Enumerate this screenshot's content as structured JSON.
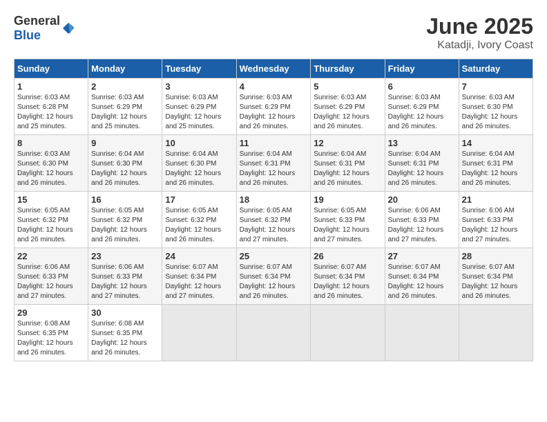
{
  "header": {
    "logo_general": "General",
    "logo_blue": "Blue",
    "month": "June 2025",
    "location": "Katadji, Ivory Coast"
  },
  "days_of_week": [
    "Sunday",
    "Monday",
    "Tuesday",
    "Wednesday",
    "Thursday",
    "Friday",
    "Saturday"
  ],
  "weeks": [
    [
      {
        "day": "1",
        "sunrise": "6:03 AM",
        "sunset": "6:28 PM",
        "daylight": "12 hours and 25 minutes."
      },
      {
        "day": "2",
        "sunrise": "6:03 AM",
        "sunset": "6:29 PM",
        "daylight": "12 hours and 25 minutes."
      },
      {
        "day": "3",
        "sunrise": "6:03 AM",
        "sunset": "6:29 PM",
        "daylight": "12 hours and 25 minutes."
      },
      {
        "day": "4",
        "sunrise": "6:03 AM",
        "sunset": "6:29 PM",
        "daylight": "12 hours and 26 minutes."
      },
      {
        "day": "5",
        "sunrise": "6:03 AM",
        "sunset": "6:29 PM",
        "daylight": "12 hours and 26 minutes."
      },
      {
        "day": "6",
        "sunrise": "6:03 AM",
        "sunset": "6:29 PM",
        "daylight": "12 hours and 26 minutes."
      },
      {
        "day": "7",
        "sunrise": "6:03 AM",
        "sunset": "6:30 PM",
        "daylight": "12 hours and 26 minutes."
      }
    ],
    [
      {
        "day": "8",
        "sunrise": "6:03 AM",
        "sunset": "6:30 PM",
        "daylight": "12 hours and 26 minutes."
      },
      {
        "day": "9",
        "sunrise": "6:04 AM",
        "sunset": "6:30 PM",
        "daylight": "12 hours and 26 minutes."
      },
      {
        "day": "10",
        "sunrise": "6:04 AM",
        "sunset": "6:30 PM",
        "daylight": "12 hours and 26 minutes."
      },
      {
        "day": "11",
        "sunrise": "6:04 AM",
        "sunset": "6:31 PM",
        "daylight": "12 hours and 26 minutes."
      },
      {
        "day": "12",
        "sunrise": "6:04 AM",
        "sunset": "6:31 PM",
        "daylight": "12 hours and 26 minutes."
      },
      {
        "day": "13",
        "sunrise": "6:04 AM",
        "sunset": "6:31 PM",
        "daylight": "12 hours and 26 minutes."
      },
      {
        "day": "14",
        "sunrise": "6:04 AM",
        "sunset": "6:31 PM",
        "daylight": "12 hours and 26 minutes."
      }
    ],
    [
      {
        "day": "15",
        "sunrise": "6:05 AM",
        "sunset": "6:32 PM",
        "daylight": "12 hours and 26 minutes."
      },
      {
        "day": "16",
        "sunrise": "6:05 AM",
        "sunset": "6:32 PM",
        "daylight": "12 hours and 26 minutes."
      },
      {
        "day": "17",
        "sunrise": "6:05 AM",
        "sunset": "6:32 PM",
        "daylight": "12 hours and 26 minutes."
      },
      {
        "day": "18",
        "sunrise": "6:05 AM",
        "sunset": "6:32 PM",
        "daylight": "12 hours and 27 minutes."
      },
      {
        "day": "19",
        "sunrise": "6:05 AM",
        "sunset": "6:33 PM",
        "daylight": "12 hours and 27 minutes."
      },
      {
        "day": "20",
        "sunrise": "6:06 AM",
        "sunset": "6:33 PM",
        "daylight": "12 hours and 27 minutes."
      },
      {
        "day": "21",
        "sunrise": "6:06 AM",
        "sunset": "6:33 PM",
        "daylight": "12 hours and 27 minutes."
      }
    ],
    [
      {
        "day": "22",
        "sunrise": "6:06 AM",
        "sunset": "6:33 PM",
        "daylight": "12 hours and 27 minutes."
      },
      {
        "day": "23",
        "sunrise": "6:06 AM",
        "sunset": "6:33 PM",
        "daylight": "12 hours and 27 minutes."
      },
      {
        "day": "24",
        "sunrise": "6:07 AM",
        "sunset": "6:34 PM",
        "daylight": "12 hours and 27 minutes."
      },
      {
        "day": "25",
        "sunrise": "6:07 AM",
        "sunset": "6:34 PM",
        "daylight": "12 hours and 26 minutes."
      },
      {
        "day": "26",
        "sunrise": "6:07 AM",
        "sunset": "6:34 PM",
        "daylight": "12 hours and 26 minutes."
      },
      {
        "day": "27",
        "sunrise": "6:07 AM",
        "sunset": "6:34 PM",
        "daylight": "12 hours and 26 minutes."
      },
      {
        "day": "28",
        "sunrise": "6:07 AM",
        "sunset": "6:34 PM",
        "daylight": "12 hours and 26 minutes."
      }
    ],
    [
      {
        "day": "29",
        "sunrise": "6:08 AM",
        "sunset": "6:35 PM",
        "daylight": "12 hours and 26 minutes."
      },
      {
        "day": "30",
        "sunrise": "6:08 AM",
        "sunset": "6:35 PM",
        "daylight": "12 hours and 26 minutes."
      },
      null,
      null,
      null,
      null,
      null
    ]
  ]
}
